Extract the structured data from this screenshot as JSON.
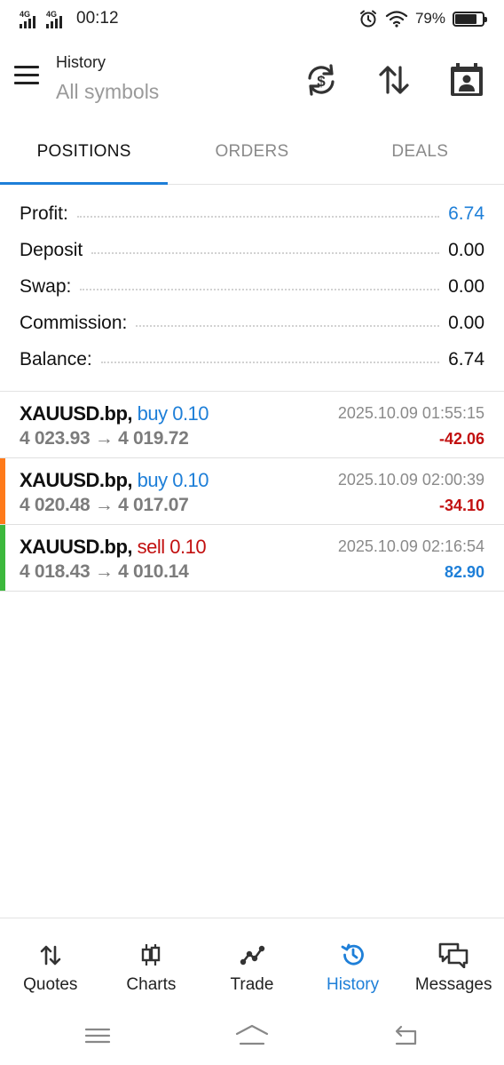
{
  "status_bar": {
    "net1": "4G",
    "net2": "4G",
    "time": "00:12",
    "battery_pct": "79%",
    "battery_level": 0.79
  },
  "header": {
    "title": "History",
    "subtitle": "All symbols"
  },
  "tabs": [
    {
      "label": "POSITIONS",
      "active": true
    },
    {
      "label": "ORDERS",
      "active": false
    },
    {
      "label": "DEALS",
      "active": false
    }
  ],
  "summary": [
    {
      "label": "Profit:",
      "value": "6.74"
    },
    {
      "label": "Deposit",
      "value": "0.00"
    },
    {
      "label": "Swap:",
      "value": "0.00"
    },
    {
      "label": "Commission:",
      "value": "0.00"
    },
    {
      "label": "Balance:",
      "value": "6.74"
    }
  ],
  "deals": [
    {
      "symbol": "XAUUSD.bp,",
      "side": "buy 0.10",
      "prices": "4 023.93 → 4 019.72",
      "time": "2025.10.09 01:55:15",
      "pl": "-42.06",
      "stripe": ""
    },
    {
      "symbol": "XAUUSD.bp,",
      "side": "buy 0.10",
      "prices": "4 020.48 → 4 017.07",
      "time": "2025.10.09 02:00:39",
      "pl": "-34.10",
      "stripe": "#ff7a1a"
    },
    {
      "symbol": "XAUUSD.bp,",
      "side": "sell 0.10",
      "prices": "4 018.43 → 4 010.14",
      "time": "2025.10.09 02:16:54",
      "pl": "82.90",
      "stripe": "#3cb83c"
    }
  ],
  "bottom_nav": [
    {
      "label": "Quotes",
      "icon": "quotes-icon",
      "active": false
    },
    {
      "label": "Charts",
      "icon": "charts-icon",
      "active": false
    },
    {
      "label": "Trade",
      "icon": "trade-icon",
      "active": false
    },
    {
      "label": "History",
      "icon": "history-icon",
      "active": true
    },
    {
      "label": "Messages",
      "icon": "messages-icon",
      "active": false
    }
  ],
  "colors": {
    "accent": "#1e7fd8",
    "loss": "#c21010",
    "stripe_orange": "#ff7a1a",
    "stripe_green": "#3cb83c"
  }
}
